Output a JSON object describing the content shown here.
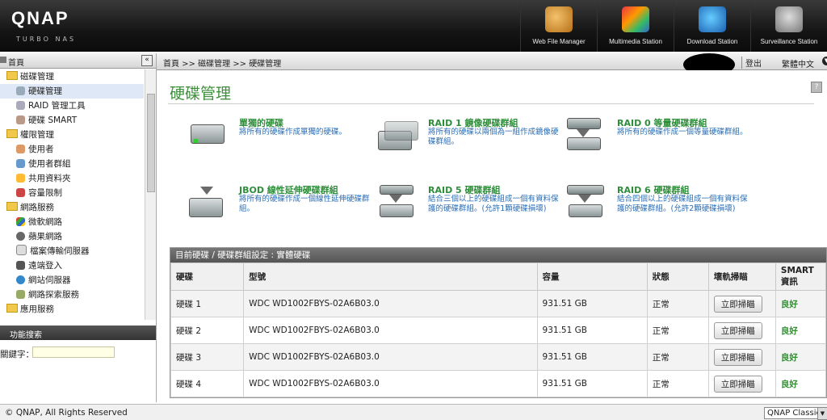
{
  "header": {
    "logo": "QNAP",
    "logo_sub": "TURBO NAS",
    "apps": [
      {
        "label": "Web File Manager",
        "icon": "web-file-manager-icon"
      },
      {
        "label": "Multimedia Station",
        "icon": "multimedia-station-icon"
      },
      {
        "label": "Download Station",
        "icon": "download-station-icon"
      },
      {
        "label": "Surveillance Station",
        "icon": "surveillance-station-icon"
      }
    ]
  },
  "sidebar": {
    "home": "首頁",
    "groups": [
      {
        "label": "磁碟管理",
        "items": [
          "硬碟管理",
          "RAID 管理工具",
          "硬碟 SMART"
        ]
      },
      {
        "label": "權限管理",
        "items": [
          "使用者",
          "使用者群組",
          "共用資料夾",
          "容量限制"
        ]
      },
      {
        "label": "網路服務",
        "items": [
          "微軟網路",
          "蘋果網路",
          "檔案傳輸伺服器",
          "遠端登入",
          "網站伺服器",
          "網路探索服務"
        ]
      },
      {
        "label": "應用服務",
        "items": []
      }
    ],
    "search_title": "功能搜索",
    "keyword_label": "關鍵字："
  },
  "topbar": {
    "breadcrumb": "首頁 >> 磁碟管理 >> 硬碟管理",
    "logout": "登出",
    "language": "繁體中文"
  },
  "main": {
    "title": "硬碟管理",
    "options": [
      {
        "title": "單獨的硬碟",
        "desc": "將所有的硬碟作成單獨的硬碟。"
      },
      {
        "title": "RAID 1 鏡像硬碟群組",
        "desc": "將所有的硬碟以兩個為一組作成鏡像硬碟群組。"
      },
      {
        "title": "RAID 0 等量硬碟群組",
        "desc": "將所有的硬碟作成一個等量硬碟群組。"
      },
      {
        "title": "JBOD 線性延伸硬碟群組",
        "desc": "將所有的硬碟作成一個線性延伸硬碟群組。"
      },
      {
        "title": "RAID 5 硬碟群組",
        "desc": "結合三個以上的硬碟組成一個有資料保護的硬碟群組。(允許1顆硬碟損壞)"
      },
      {
        "title": "RAID 6 硬碟群組",
        "desc": "結合四個以上的硬碟組成一個有資料保護的硬碟群組。(允許2顆硬碟損壞)"
      }
    ],
    "grid": {
      "title": "目前硬碟 / 硬碟群組設定 : 實體硬碟",
      "columns": [
        "硬碟",
        "型號",
        "容量",
        "狀態",
        "壞軌掃瞄",
        "SMART 資訊"
      ],
      "rows": [
        {
          "disk": "硬碟 1",
          "model": "WDC WD1002FBYS-02A6B03.0",
          "capacity": "931.51 GB",
          "status": "正常",
          "scan": "立即掃瞄",
          "smart": "良好"
        },
        {
          "disk": "硬碟 2",
          "model": "WDC WD1002FBYS-02A6B03.0",
          "capacity": "931.51 GB",
          "status": "正常",
          "scan": "立即掃瞄",
          "smart": "良好"
        },
        {
          "disk": "硬碟 3",
          "model": "WDC WD1002FBYS-02A6B03.0",
          "capacity": "931.51 GB",
          "status": "正常",
          "scan": "立即掃瞄",
          "smart": "良好"
        },
        {
          "disk": "硬碟 4",
          "model": "WDC WD1002FBYS-02A6B03.0",
          "capacity": "931.51 GB",
          "status": "正常",
          "scan": "立即掃瞄",
          "smart": "良好"
        }
      ]
    }
  },
  "footer": {
    "copyright": "© QNAP, All Rights Reserved",
    "theme": "QNAP Classic"
  },
  "colors": {
    "accent_green": "#3e8f3c",
    "link_blue": "#2a6db5"
  }
}
